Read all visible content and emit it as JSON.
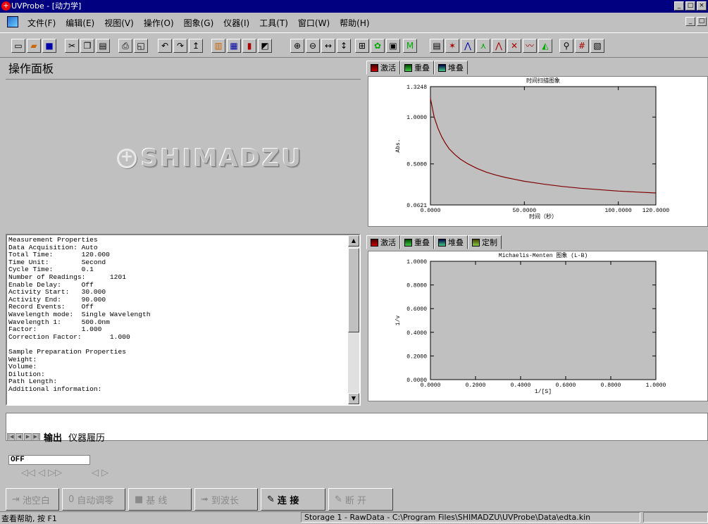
{
  "window": {
    "title": "UVProbe - [动力学]",
    "app_icon": "shimadzu-icon",
    "buttons": [
      "_",
      "□",
      "×"
    ]
  },
  "menu": [
    "文件(F)",
    "编辑(E)",
    "视图(V)",
    "操作(O)",
    "图象(G)",
    "仪器(I)",
    "工具(T)",
    "窗口(W)",
    "帮助(H)"
  ],
  "op_panel": {
    "title": "操作面板",
    "logo_text": "SHIMADZU"
  },
  "properties_lines": [
    "Measurement Properties",
    "Data Acquisition: Auto",
    "Total Time:       120.000",
    "Time Unit:        Second",
    "Cycle Time:       0.1",
    "Number of Readings:      1201",
    "Enable Delay:     Off",
    "Activity Start:   30.000",
    "Activity End:     90.000",
    "Record Events:    Off",
    "Wavelength mode:  Single Wavelength",
    "Wavelength 1:     500.0nm",
    "Factor:           1.000",
    "Correction Factor:       1.000",
    "",
    "Sample Preparation Properties",
    "Weight:",
    "Volume:",
    "Dilution:",
    "Path Length:",
    "Additional information:"
  ],
  "top_tabs": [
    "激活",
    "重叠",
    "堆叠"
  ],
  "bottom_tabs": [
    "激活",
    "重叠",
    "堆叠",
    "定制"
  ],
  "chart_data": [
    {
      "type": "line",
      "title": "时间扫描图象",
      "xlabel": "时间（秒）",
      "ylabel": "Abs.",
      "xlim": [
        0,
        120
      ],
      "ylim": [
        0.0621,
        1.3248
      ],
      "x_ticks": [
        "0.0000",
        "50.0000",
        "100.0000",
        "120.0000"
      ],
      "y_ticks": [
        "1.3248",
        "1.0000",
        "0.5000",
        "0.0621"
      ],
      "series": [
        {
          "color": "#800000",
          "x": [
            0,
            2,
            4,
            6,
            8,
            10,
            13,
            16,
            20,
            25,
            30,
            35,
            40,
            45,
            50,
            55,
            60,
            70,
            80,
            90,
            100,
            110,
            120
          ],
          "y": [
            1.2,
            1.0,
            0.88,
            0.79,
            0.72,
            0.66,
            0.6,
            0.55,
            0.5,
            0.45,
            0.41,
            0.38,
            0.355,
            0.335,
            0.315,
            0.3,
            0.285,
            0.26,
            0.24,
            0.225,
            0.21,
            0.2,
            0.19
          ]
        }
      ],
      "grid": false
    },
    {
      "type": "scatter",
      "title": "Michaelis-Menten 图象 (L-B)",
      "xlabel": "1/[S]",
      "ylabel": "1/v",
      "xlim": [
        0,
        1
      ],
      "ylim": [
        0,
        1
      ],
      "x_ticks": [
        "0.0000",
        "0.2000",
        "0.4000",
        "0.6000",
        "0.8000",
        "1.0000"
      ],
      "y_ticks": [
        "1.0000",
        "0.8000",
        "0.6000",
        "0.4000",
        "0.2000",
        "0.0000"
      ],
      "series": [],
      "grid": false
    }
  ],
  "output_tabs": [
    "输出",
    "仪器履历"
  ],
  "status_indicator": "OFF",
  "bottom_buttons": [
    {
      "label": "池空白",
      "enabled": false,
      "icon": "cell-blank-icon"
    },
    {
      "label": "自动调零",
      "enabled": false,
      "icon": "auto-zero-icon"
    },
    {
      "label": "基 线",
      "enabled": false,
      "icon": "baseline-icon"
    },
    {
      "label": "到波长",
      "enabled": false,
      "icon": "goto-wavelength-icon"
    },
    {
      "label": "连 接",
      "enabled": true,
      "icon": "connect-icon"
    },
    {
      "label": "断 开",
      "enabled": false,
      "icon": "disconnect-icon"
    }
  ],
  "statusbar": {
    "help": "查看帮助, 按 F1",
    "storage": "Storage 1 - RawData - C:\\Program Files\\SHIMADZU\\UVProbe\\Data\\edta.kin"
  }
}
